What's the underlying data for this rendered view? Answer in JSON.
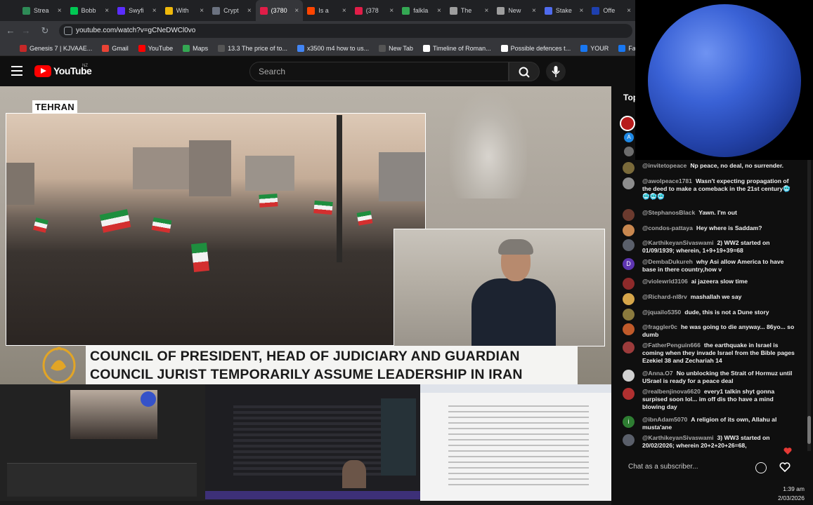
{
  "browser": {
    "tabs": [
      {
        "title": "Strea",
        "color": "#2e8b57"
      },
      {
        "title": "Bobb",
        "color": "#00c853"
      },
      {
        "title": "Swyfi",
        "color": "#5b2dff"
      },
      {
        "title": "With",
        "color": "#f0b90b"
      },
      {
        "title": "Crypt",
        "color": "#6b7280"
      },
      {
        "title": "(3780",
        "color": "#e11d48"
      },
      {
        "title": "Is a",
        "color": "#ff4500"
      },
      {
        "title": "(378",
        "color": "#e11d48"
      },
      {
        "title": "falkla",
        "color": "#34a853"
      },
      {
        "title": "The",
        "color": "#9e9e9e"
      },
      {
        "title": "New",
        "color": "#9e9e9e"
      },
      {
        "title": "Stake",
        "color": "#4f6bed"
      },
      {
        "title": "Offe",
        "color": "#1e40af"
      }
    ],
    "url": "youtube.com/watch?v=gCNeDWCl0vo",
    "bookmarks": [
      {
        "label": "Genesis 7 | KJVAAE...",
        "color": "#c62828"
      },
      {
        "label": "Gmail",
        "color": "#ea4335"
      },
      {
        "label": "YouTube",
        "color": "#ff0000"
      },
      {
        "label": "Maps",
        "color": "#34a853"
      },
      {
        "label": "13.3 The price of to...",
        "color": "#555"
      },
      {
        "label": "x3500 m4 how to us...",
        "color": "#4285f4"
      },
      {
        "label": "New Tab",
        "color": "#555"
      },
      {
        "label": "Timeline of Roman...",
        "color": "#ffffff"
      },
      {
        "label": "Possible defences t...",
        "color": "#ffffff"
      },
      {
        "label": "YOUR",
        "color": "#1877f2"
      },
      {
        "label": "Facebook green",
        "color": "#1877f2"
      }
    ]
  },
  "youtube": {
    "logo_text": "YouTube",
    "country": "NZ",
    "search_placeholder": "Search"
  },
  "video": {
    "location_label": "TEHRAN",
    "headline_line1": "COUNCIL OF PRESIDENT, HEAD OF JUDICIARY AND GUARDIAN",
    "headline_line2": "COUNCIL JURIST TEMPORARILY ASSUME LEADERSHIP IN IRAN"
  },
  "chat": {
    "title": "Top",
    "input_placeholder": "Chat as a subscriber...",
    "messages": [
      {
        "author": "@invitetopeace",
        "text": "Np peace, no deal, no surrender.",
        "avatar_color": "#7a6a3a",
        "avatar_letter": ""
      },
      {
        "author": "@awolpeace1781",
        "text": "Wasn't expecting propagation of the deed to make a comeback in the 21st century🥶🥶🥶🥶",
        "avatar_color": "#8d8d8d",
        "avatar_letter": ""
      },
      {
        "author": "@StephanosBlack",
        "text": "Yawn. I'm out",
        "avatar_color": "#6b3a2e",
        "avatar_letter": ""
      },
      {
        "author": "@condos-pattaya",
        "text": "Hey where is Saddam?",
        "avatar_color": "#c8874f",
        "avatar_letter": ""
      },
      {
        "author": "@KarthikeyanSivaswami",
        "text": "2) WW2 started on 01/09/1939; wherein, 1+9+19+39=68",
        "avatar_color": "#5a5f6a",
        "avatar_letter": ""
      },
      {
        "author": "@DembaDukureh",
        "text": "why Asi allow America to have base in there country,how v",
        "avatar_color": "#5e35b1",
        "avatar_letter": "D"
      },
      {
        "author": "@violewrld3106",
        "text": "ai jazeera slow time",
        "avatar_color": "#8e2a2a",
        "avatar_letter": ""
      },
      {
        "author": "@Richard-nl8rv",
        "text": "mashallah we say",
        "avatar_color": "#d6a64a",
        "avatar_letter": ""
      },
      {
        "author": "@jquailo5350",
        "text": "dude, this is not a Dune story",
        "avatar_color": "#8a7a3e",
        "avatar_letter": ""
      },
      {
        "author": "@fraggler0c",
        "text": "he was going to die anyway... 86yo... so dumb",
        "avatar_color": "#c05a2a",
        "avatar_letter": ""
      },
      {
        "author": "@FatherPenguin666",
        "text": "the earthquake in Israel is coming when they invade Israel from the Bible pages Ezekiel 38 and Zechariah 14",
        "avatar_color": "#9c3b3b",
        "avatar_letter": ""
      },
      {
        "author": "@Anna.O7",
        "text": "No unblocking the Strait of Hormuz until USrael is ready for a peace deal",
        "avatar_color": "#d0d0d0",
        "avatar_letter": ""
      },
      {
        "author": "@realbenjinova6620",
        "text": "every1 talkin shyt gonna surpised soon lol... im off dis tho have a mind blowing day",
        "avatar_color": "#b03030",
        "avatar_letter": ""
      },
      {
        "author": "@ibnAdam5070",
        "text": "A religion of its own, Allahu al musta'ane",
        "avatar_color": "#2e7d32",
        "avatar_letter": "i"
      },
      {
        "author": "@KarthikeyanSivaswami",
        "text": "3) WW3 started on 20/02/2026; wherein 20+2+20+26=68,",
        "avatar_color": "#5a5f6a",
        "avatar_letter": ""
      }
    ]
  },
  "taskbar": {
    "time": "1:39 am",
    "date": "2/03/2026"
  }
}
